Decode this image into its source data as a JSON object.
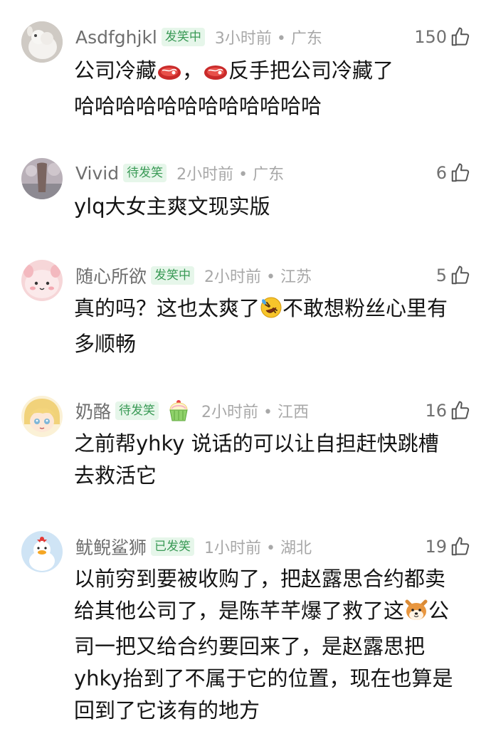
{
  "comments": [
    {
      "username": "Asdfghjkl",
      "badge": "发笑中",
      "time": "3小时前 • 广东",
      "likes": "150",
      "text": {
        "part1": "公司冷藏",
        "part2": "，",
        "part3": "反手把公司冷藏了",
        "line2": "哈哈哈哈哈哈哈哈哈哈哈哈"
      },
      "emoji": "meat-emoji"
    },
    {
      "username": "Vivid",
      "badge": "待发笑",
      "time": "2小时前 • 广东",
      "likes": "6",
      "text": {
        "line1": "ylq大女主爽文现实版"
      }
    },
    {
      "username": "随心所欲",
      "badge": "发笑中",
      "time": "2小时前 • 江苏",
      "likes": "5",
      "text": {
        "part1": "真的吗？这也太爽了",
        "part2": "不敢想粉丝心里有",
        "line2": "多顺畅"
      },
      "emoji": "rofl-emoji"
    },
    {
      "username": "奶酪",
      "badge": "待发笑",
      "time": "2小时前 • 江西",
      "likes": "16",
      "text": {
        "line1": "之前帮yhky 说话的可以让自担赶快跳槽",
        "line2": "去救活它"
      },
      "decoration": "cupcake-icon"
    },
    {
      "username": "鱿鲵鲨狮",
      "badge": "已发笑",
      "time": "1小时前 • 湖北",
      "likes": "19",
      "text": {
        "line1": "以前穷到要被收购了，把赵露思合约都卖",
        "line2a": "给其他公司了，是陈芊芊爆了救了这",
        "line2b": "公",
        "line3": "司一把又给合约要回来了，是赵露思把",
        "line4": "yhky抬到了不属于它的位置，现在也算是",
        "line5": "回到了它该有的地方"
      },
      "emoji": "shiba-dog-emoji"
    }
  ],
  "colors": {
    "badge_green": "#3a9a56",
    "badge_bg": "#e6f6ea",
    "username_gray": "#6e6e6e",
    "time_gray": "#a8a8a8"
  }
}
